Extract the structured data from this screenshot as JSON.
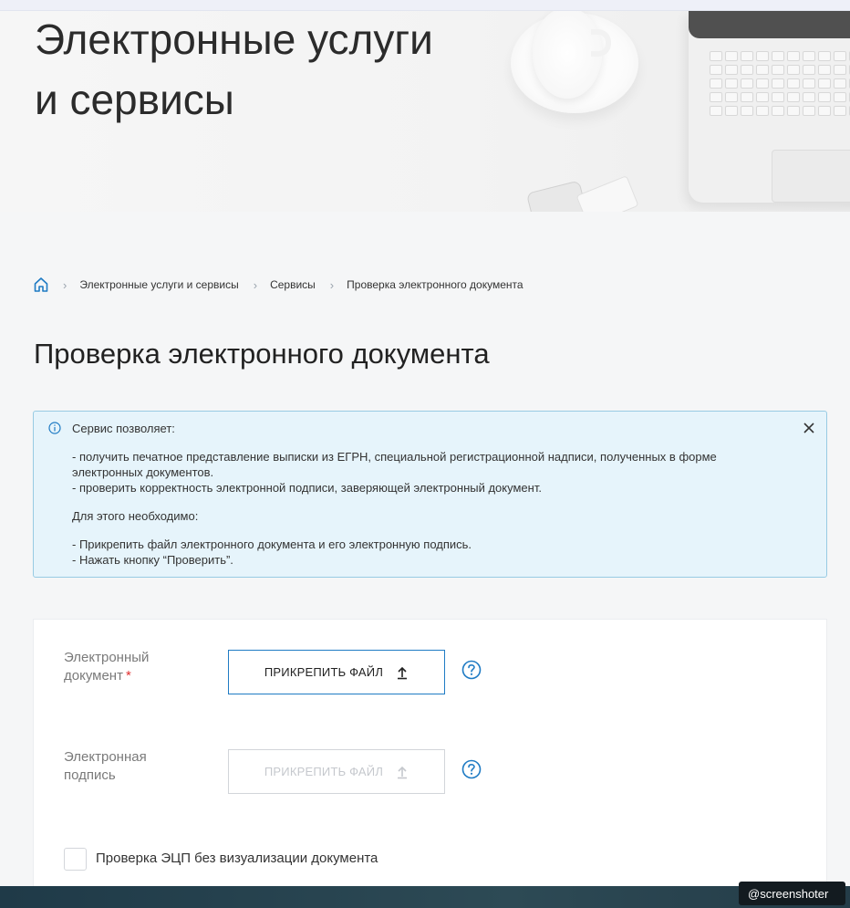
{
  "hero": {
    "title_line1": "Электронные услуги",
    "title_line2": "и сервисы"
  },
  "breadcrumb": {
    "home_icon": "home-icon",
    "items": [
      "Электронные услуги и сервисы",
      "Сервисы",
      "Проверка электронного документа"
    ],
    "separator": "›"
  },
  "page": {
    "title": "Проверка электронного документа"
  },
  "info": {
    "icon": "info-icon",
    "heading": "Сервис позволяет:",
    "bullets": [
      "- получить печатное представление выписки из ЕГРН, специальной регистрационной надписи, полученных в форме",
      "электронных документов.",
      "- проверить корректность электронной подписи, заверяющей электронный документ."
    ],
    "requirement_heading": "Для этого необходимо:",
    "steps": [
      "- Прикрепить файл электронного документа и его электронную подпись.",
      "- Нажать кнопку “Проверить”."
    ],
    "close_icon": "close-icon"
  },
  "form": {
    "document_field": {
      "label_line1": "Электронный",
      "label_line2": "документ",
      "required_mark": "*",
      "button_label": "ПРИКРЕПИТЬ ФАЙЛ",
      "button_icon": "upload-icon",
      "help_icon": "help-icon"
    },
    "signature_field": {
      "label_line1": "Электронная",
      "label_line2": "подпись",
      "button_label": "ПРИКРЕПИТЬ ФАЙЛ",
      "button_icon": "upload-icon",
      "help_icon": "help-icon"
    },
    "checkbox_label": "Проверка ЭЦП без визуализации документа"
  },
  "watermark": "@screenshoter",
  "colors": {
    "accent": "#1f7bc4",
    "info_bg": "#e6f4fb",
    "info_border": "#98cbe3",
    "required": "#e03131"
  }
}
